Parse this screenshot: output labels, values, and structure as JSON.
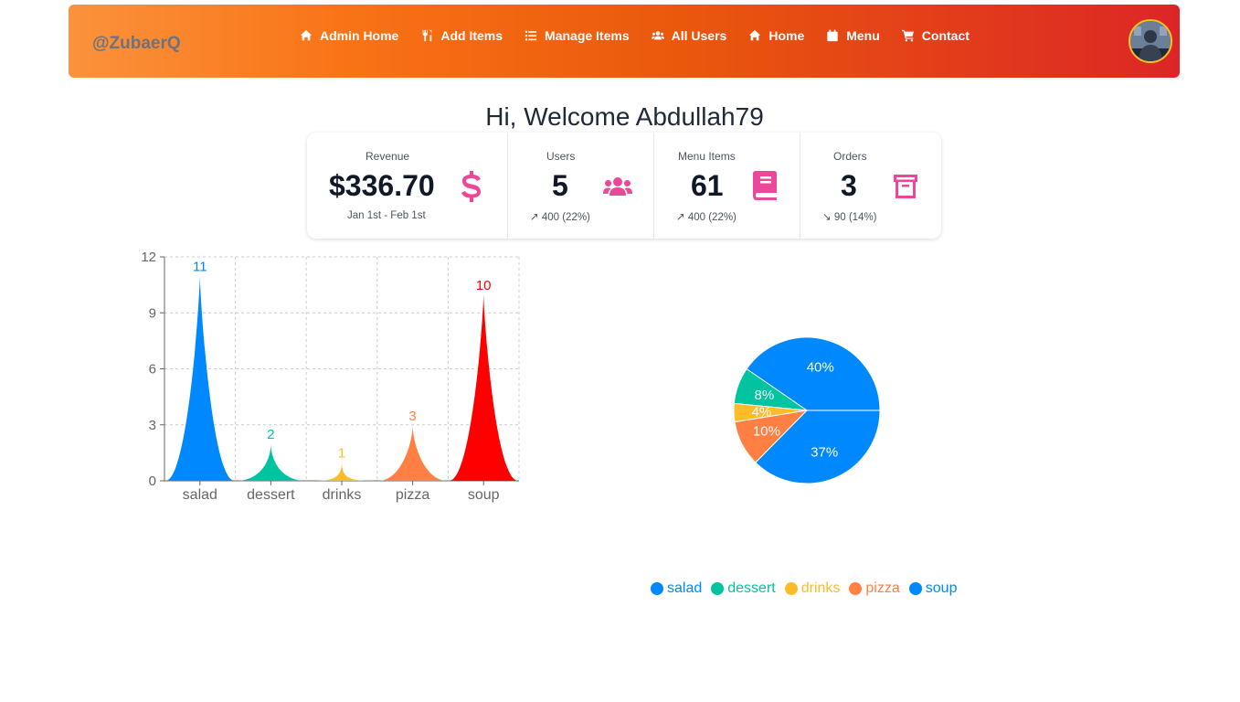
{
  "navbar": {
    "brand": "@ZubaerQ",
    "links": [
      {
        "label": "Admin Home",
        "icon": "home-icon"
      },
      {
        "label": "Add Items",
        "icon": "utensils-icon"
      },
      {
        "label": "Manage Items",
        "icon": "list-icon"
      },
      {
        "label": "All Users",
        "icon": "users-icon"
      },
      {
        "label": "Home",
        "icon": "home-icon"
      },
      {
        "label": "Menu",
        "icon": "calendar-icon"
      },
      {
        "label": "Contact",
        "icon": "cart-icon"
      }
    ]
  },
  "welcome": "Hi, Welcome Abdullah79",
  "stats": [
    {
      "title": "Revenue",
      "value": "$336.70",
      "desc": "Jan 1st - Feb 1st",
      "icon": "dollar-icon"
    },
    {
      "title": "Users",
      "value": "5",
      "desc": "↗ 400 (22%)",
      "icon": "users-icon"
    },
    {
      "title": "Menu Items",
      "value": "61",
      "desc": "↗ 400 (22%)",
      "icon": "book-icon"
    },
    {
      "title": "Orders",
      "value": "3",
      "desc": "↘ 90 (14%)",
      "icon": "archive-icon"
    }
  ],
  "colors": {
    "accent": "#ec4899",
    "salad": "#0088FE",
    "dessert": "#00C49F",
    "drinks": "#FFBB28",
    "pizza": "#FF8042",
    "soup": "#FF0000",
    "pie_soup": "#0088FE"
  },
  "chart_data": [
    {
      "type": "bar",
      "categories": [
        "salad",
        "dessert",
        "drinks",
        "pizza",
        "soup"
      ],
      "values": [
        11,
        2,
        1,
        3,
        10
      ],
      "ylim": [
        0,
        12
      ],
      "yticks": [
        "0",
        "3",
        "6",
        "9",
        "12"
      ],
      "grid": true
    },
    {
      "type": "pie",
      "labels": [
        "salad",
        "dessert",
        "drinks",
        "pizza",
        "soup"
      ],
      "values": [
        40,
        8,
        4,
        10,
        37
      ],
      "percent_labels": [
        "40%",
        "8%",
        "4%",
        "10%",
        "37%"
      ],
      "legend": "bottom"
    }
  ]
}
